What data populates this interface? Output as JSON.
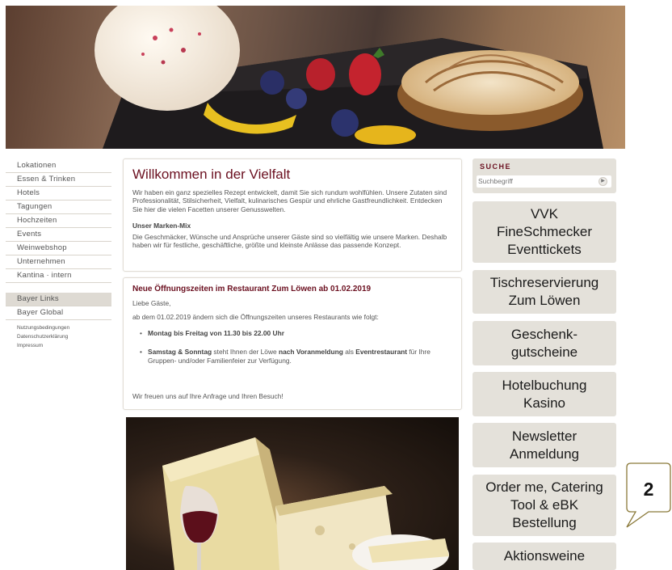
{
  "nav": {
    "main": [
      "Lokationen",
      "Essen & Trinken",
      "Hotels",
      "Tagungen",
      "Hochzeiten",
      "Events",
      "Weinwebshop",
      "Unternehmen",
      "Kantina · intern"
    ],
    "links": [
      "Bayer Links",
      "Bayer Global"
    ],
    "small": [
      "Nutzungsbedingungen",
      "Datenschutzerklärung",
      "Impressum"
    ]
  },
  "welcome": {
    "title": "Willkommen in der Vielfalt",
    "text": "Wir haben ein ganz spezielles Rezept entwickelt, damit Sie sich rundum wohlfühlen. Unsere Zutaten sind Professionalität, Stilsicherheit, Vielfalt, kulinarisches Gespür und ehrliche Gastfreundlichkeit. Entdecken Sie hier die vielen Facetten unserer Genusswelten.",
    "subtitle": "Unser Marken-Mix",
    "text2": "Die Geschmäcker, Wünsche und Ansprüche unserer Gäste sind so vielfältig wie unsere Marken. Deshalb haben wir für festliche, geschäftliche, größte und kleinste Anlässe das passende Konzept."
  },
  "news": {
    "title": "Neue Öffnungszeiten im Restaurant Zum Löwen ab 01.02.2019",
    "greeting": "Liebe Gäste,",
    "intro": "ab dem 01.02.2019 ändern sich die Öffnungszeiten unseres Restaurants wie folgt:",
    "item1": "Montag bis Freitag von 11.30 bis 22.00 Uhr",
    "item2_bold1": "Samstag & Sonntag",
    "item2_text1": " steht Ihnen der Löwe ",
    "item2_bold2": "nach Voranmeldung",
    "item2_text2": " als ",
    "item2_bold3": "Eventrestaurant",
    "item2_text3": " für Ihre Gruppen- und/oder Familienfeier zur Verfügung.",
    "closing": "Wir freuen uns auf Ihre Anfrage und Ihren Besuch!"
  },
  "search": {
    "title": "SUCHE",
    "placeholder": "Suchbegriff",
    "go": "▶"
  },
  "buttons": [
    "VVK\nFineSchmecker\nEventtickets",
    "Tischreservierung\nZum Löwen",
    "Geschenk-\ngutscheine",
    "Hotelbuchung\nKasino",
    "Newsletter\nAnmeldung",
    "Order me, Catering\nTool & eBK\nBestellung",
    "Aktionsweine"
  ],
  "callout": {
    "number": "2"
  }
}
